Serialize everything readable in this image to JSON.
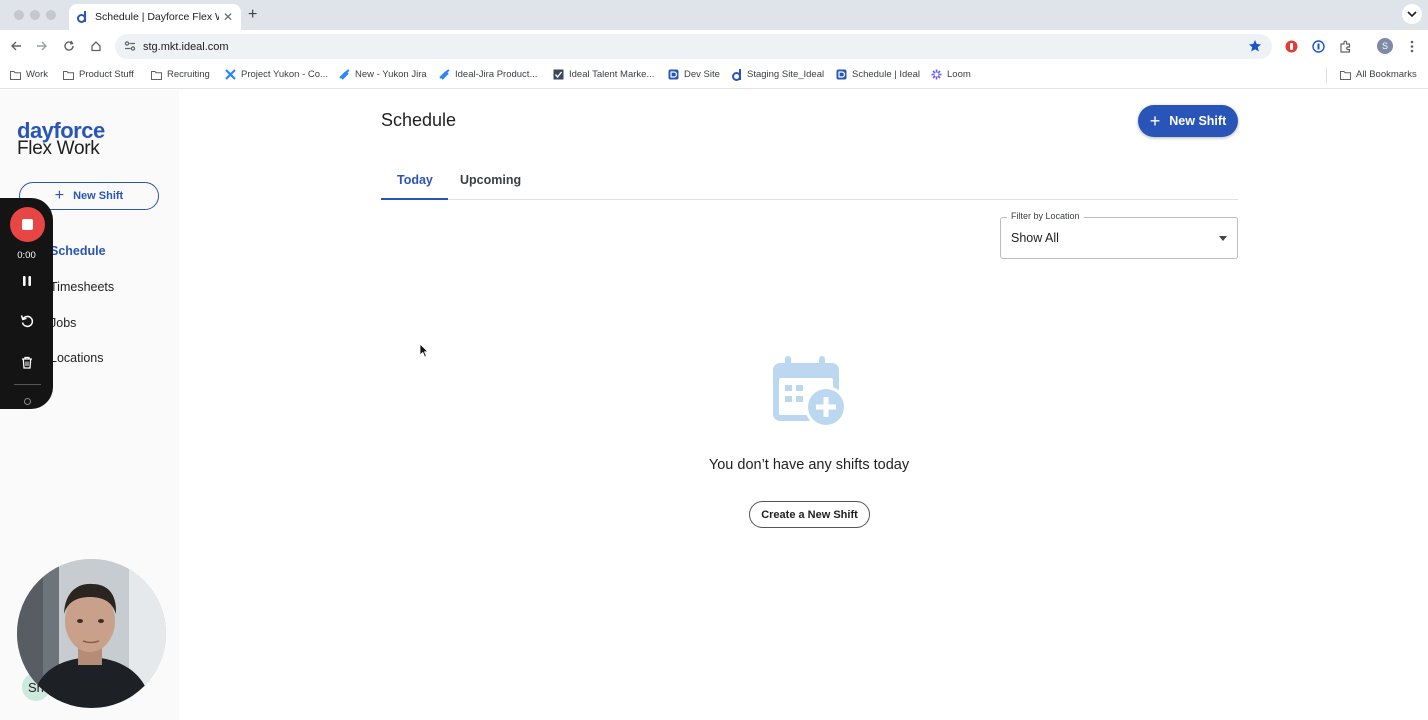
{
  "browser": {
    "tab_title": "Schedule | Dayforce Flex Wor",
    "url": "stg.mkt.ideal.com",
    "profile_initial": "S",
    "bookmarks": [
      {
        "label": "Work",
        "icon": "folder-icon"
      },
      {
        "label": "Product Stuff",
        "icon": "folder-icon"
      },
      {
        "label": "Recruiting",
        "icon": "folder-icon"
      },
      {
        "label": "Project Yukon - Co...",
        "icon": "jira-icon"
      },
      {
        "label": "New - Yukon Jira",
        "icon": "jira-icon"
      },
      {
        "label": "Ideal-Jira Product...",
        "icon": "jira-icon"
      },
      {
        "label": "Ideal Talent Marke...",
        "icon": "ideal-icon"
      },
      {
        "label": "Dev Site",
        "icon": "dayforce-icon"
      },
      {
        "label": "Staging Site_Ideal",
        "icon": "dayforce-icon"
      },
      {
        "label": "Schedule | Ideal",
        "icon": "dayforce-icon"
      },
      {
        "label": "Loom",
        "icon": "loom-icon"
      }
    ],
    "all_bookmarks_label": "All Bookmarks"
  },
  "sidebar": {
    "logo_top": "dayforce",
    "logo_bottom": "Flex Work",
    "new_shift_label": "New Shift",
    "items": [
      {
        "label": "Schedule",
        "active": true
      },
      {
        "label": "Timesheets",
        "active": false
      },
      {
        "label": "Jobs",
        "active": false
      },
      {
        "label": "Locations",
        "active": false
      }
    ],
    "avatar_text": "Sh"
  },
  "main": {
    "title": "Schedule",
    "new_shift_label": "New Shift",
    "tabs": [
      {
        "label": "Today",
        "active": true
      },
      {
        "label": "Upcoming",
        "active": false
      }
    ],
    "filter": {
      "label": "Filter by Location",
      "value": "Show All"
    },
    "empty_state": {
      "icon": "calendar-add-icon",
      "message": "You don’t have any shifts today",
      "button_label": "Create a New Shift"
    }
  },
  "recorder": {
    "time": "0:00"
  },
  "colors": {
    "brand": "#2a55b8",
    "record_red": "#e84545",
    "empty_icon": "#bcd8f1"
  }
}
